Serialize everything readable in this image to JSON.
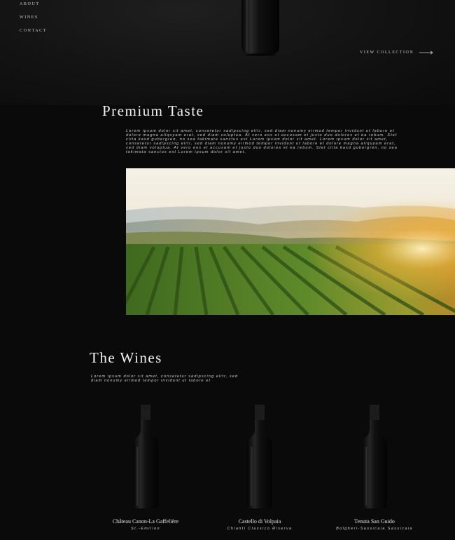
{
  "nav": {
    "items": [
      {
        "label": "ABOUT"
      },
      {
        "label": "WINES"
      },
      {
        "label": "CONTACT"
      }
    ]
  },
  "hero": {
    "cta_label": "VIEW COLLECTION",
    "cta_icon": "arrow-right-icon"
  },
  "premium": {
    "title": "Premium Taste",
    "body": "Lorem ipsum dolor sit amet, consetetur sadipscing elitr, sed diam nonumy eirmod tempor invidunt ut labore et dolore magna aliquyam erat, sed diam voluptua. At vero eos et accusam et justo duo dolores et ea rebum. Stet clita kasd gubergren, no sea takimata sanctus est Lorem ipsum dolor sit amet. Lorem ipsum dolor sit amet, consetetur sadipscing elitr, sed diam nonumy eirmod tempor invidunt ut labore et dolore magna aliquyam erat, sed diam voluptua. At vero eos et accusam et justo duo dolores et ea rebum. Stet clita kasd gubergren, no sea takimata sanctus est Lorem ipsum dolor sit amet."
  },
  "wines": {
    "title": "The Wines",
    "body": "Lorem ipsum dolor sit amet, consetetur sadipscing elitr, sed diam nonumy eirmod tempor invidunt ut labore et",
    "items": [
      {
        "name": "Château Canon-La Gaffelière",
        "region": "St.-Emilion"
      },
      {
        "name": "Castello di Volpaia",
        "region": "Chianti Classico Riserva"
      },
      {
        "name": "Tenuta San Guido",
        "region": "Bolgheri-Sassicaia Sassicaia"
      }
    ]
  },
  "colors": {
    "background": "#0a0a0a",
    "text": "#e6e6e6",
    "accent_sun": "#f2b23a"
  }
}
